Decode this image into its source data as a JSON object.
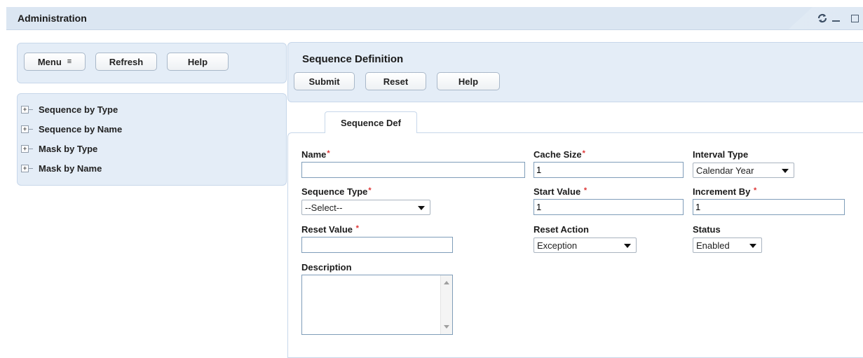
{
  "window": {
    "title": "Administration",
    "icons": [
      "refresh-icon",
      "minimize-icon",
      "maximize-icon"
    ]
  },
  "left_panel": {
    "toolbar": {
      "menu_label": "Menu",
      "menu_icon": "≡",
      "refresh_label": "Refresh",
      "help_label": "Help"
    },
    "tree": [
      {
        "label": "Sequence by Type"
      },
      {
        "label": "Sequence by Name"
      },
      {
        "label": "Mask by Type"
      },
      {
        "label": "Mask by Name"
      }
    ]
  },
  "main": {
    "header": {
      "title": "Sequence Definition",
      "submit_label": "Submit",
      "reset_label": "Reset",
      "help_label": "Help"
    },
    "tab": {
      "label": "Sequence Def"
    },
    "form": {
      "name": {
        "label": "Name",
        "value": ""
      },
      "cache_size": {
        "label": "Cache Size",
        "value": "1"
      },
      "interval_type": {
        "label": "Interval Type",
        "selected": "Calendar Year"
      },
      "sequence_type": {
        "label": "Sequence Type",
        "selected": "--Select--"
      },
      "start_value": {
        "label": "Start Value",
        "value": "1"
      },
      "increment_by": {
        "label": "Increment By",
        "value": "1"
      },
      "reset_value": {
        "label": "Reset Value",
        "value": ""
      },
      "reset_action": {
        "label": "Reset Action",
        "selected": "Exception"
      },
      "status": {
        "label": "Status",
        "selected": "Enabled"
      },
      "description": {
        "label": "Description",
        "value": ""
      },
      "required_marker": "*"
    }
  },
  "colors": {
    "panel_bg": "#e4edf7",
    "required": "#dd3333",
    "input_border": "#7f9db9"
  }
}
